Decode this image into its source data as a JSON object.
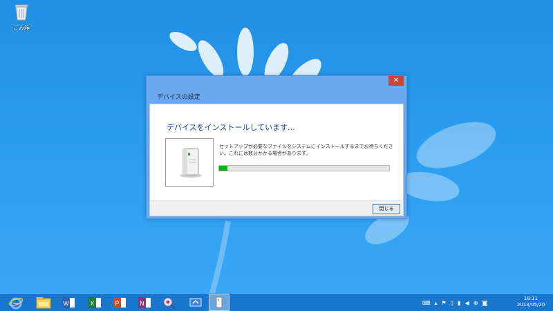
{
  "desktop": {
    "recycle_bin_label": "ごみ箱"
  },
  "dialog": {
    "title": "デバイスの設定",
    "close_glyph": "✕",
    "heading": "デバイスをインストールしています...",
    "description": "セットアップが必要なファイルをシステムにインストールするまでお待ちください。これには数分かかる場合があります。",
    "progress_fraction": 0.05,
    "close_button_label": "閉じる",
    "colors": {
      "progress": "#12b01a",
      "heading": "#1b3e8f"
    }
  },
  "taskbar": {
    "items": [
      {
        "name": "internet-explorer-icon"
      },
      {
        "name": "file-explorer-icon"
      },
      {
        "name": "word-icon",
        "letter": "W"
      },
      {
        "name": "excel-icon",
        "letter": "X"
      },
      {
        "name": "powerpoint-icon",
        "letter": "P"
      },
      {
        "name": "onenote-icon",
        "letter": "N"
      },
      {
        "name": "network-tool-icon"
      },
      {
        "name": "remote-desktop-icon"
      },
      {
        "name": "device-setup-icon"
      }
    ],
    "clock": {
      "time": "18:11",
      "date": "2013/05/20"
    }
  }
}
